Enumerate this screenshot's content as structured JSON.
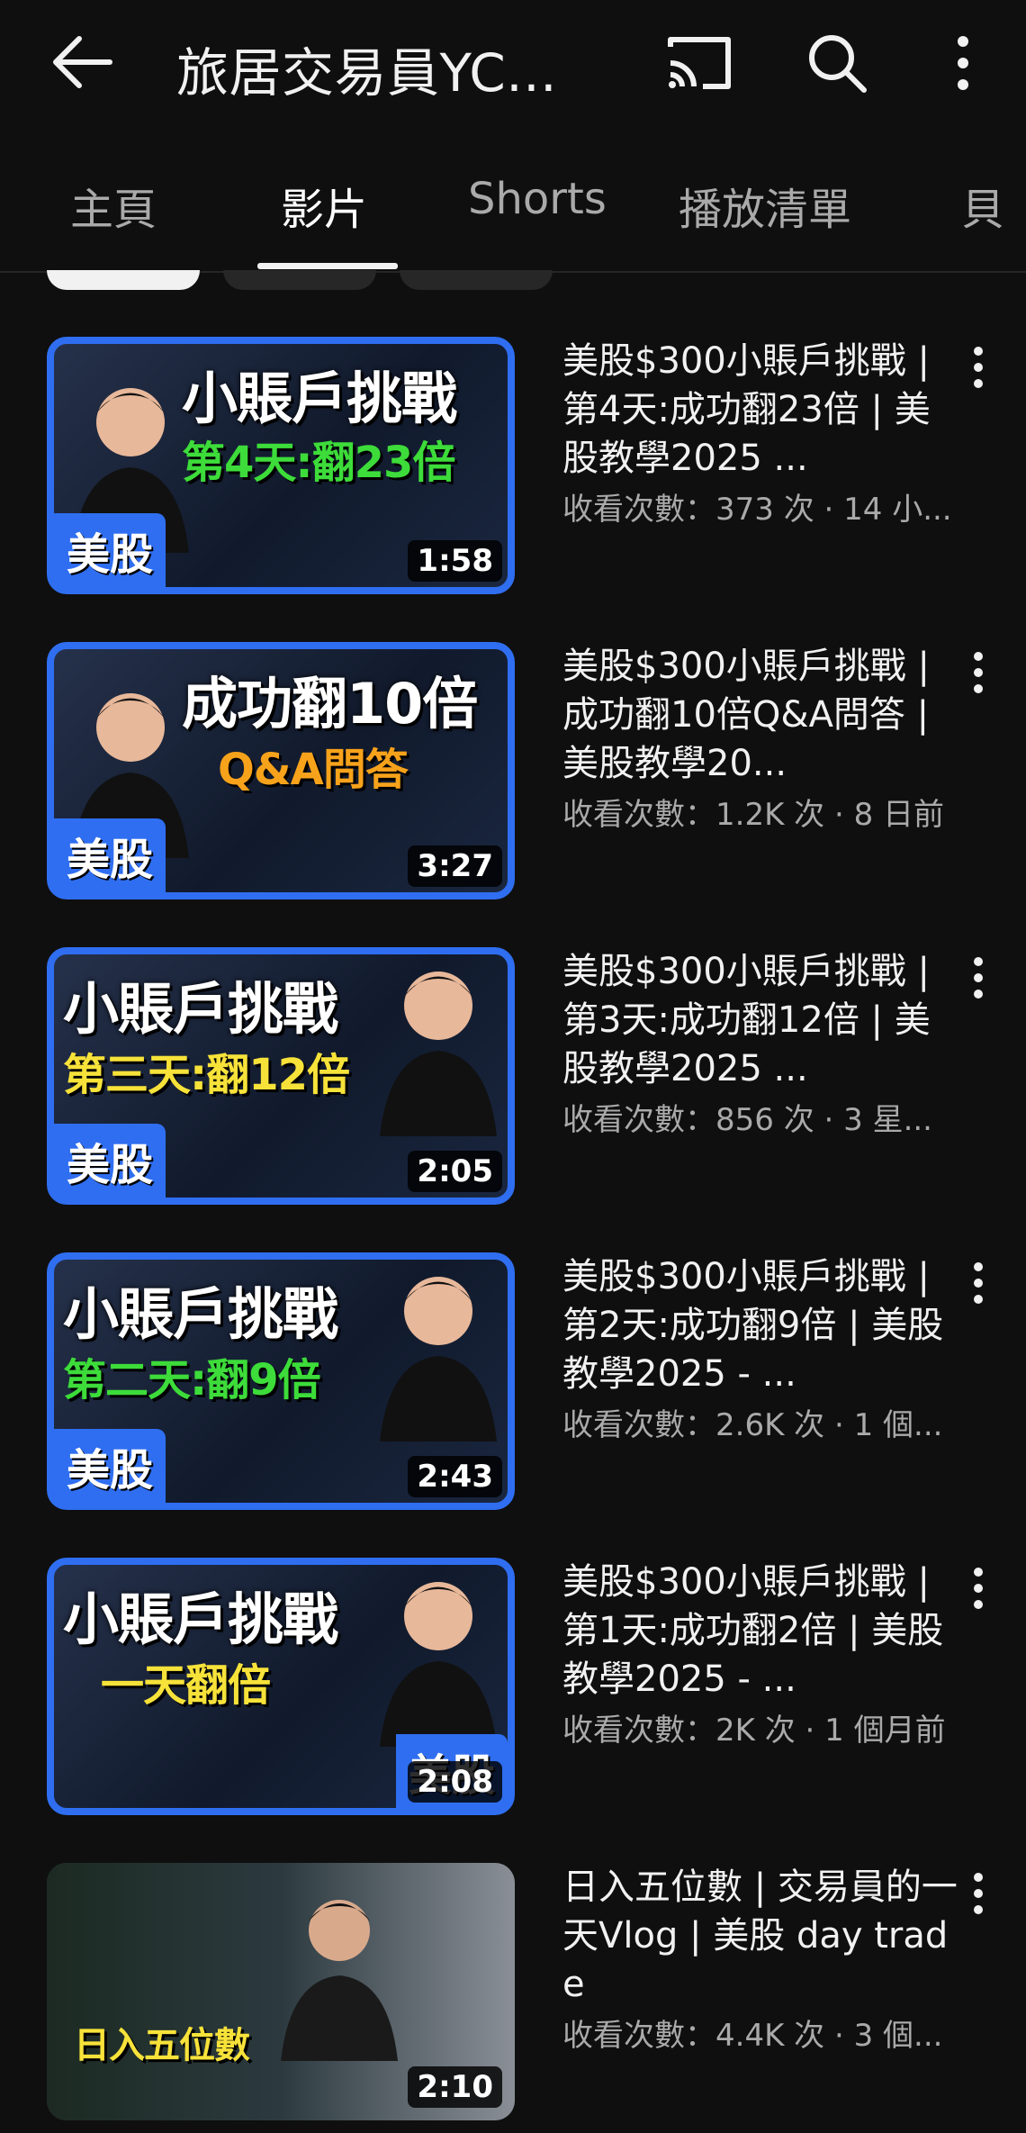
{
  "header": {
    "channel_title": "旅居交易員YC...",
    "back_icon": "arrow-back-icon",
    "cast_icon": "cast-icon",
    "search_icon": "search-icon",
    "more_icon": "more-vert-icon"
  },
  "tabs": [
    {
      "label": "主頁",
      "active": false
    },
    {
      "label": "影片",
      "active": true
    },
    {
      "label": "Shorts",
      "active": false
    },
    {
      "label": "播放清單",
      "active": false
    },
    {
      "label": "貝",
      "active": false
    }
  ],
  "videos": [
    {
      "title": "美股$300小賬戶挑戰 | 第4天:成功翻23倍 | 美股教學2025 ...",
      "meta": "收看次數：373 次 · 14 小...",
      "duration": "1:58",
      "thumb_headline": "小賬戶挑戰",
      "thumb_sub": "第4天:翻23倍",
      "thumb_badge": "美股"
    },
    {
      "title": "美股$300小賬戶挑戰 | 成功翻10倍Q&A問答 | 美股教學20...",
      "meta": "收看次數：1.2K 次 · 8 日前",
      "duration": "3:27",
      "thumb_headline": "成功翻10倍",
      "thumb_sub": "Q&A問答",
      "thumb_badge": "美股"
    },
    {
      "title": "美股$300小賬戶挑戰 | 第3天:成功翻12倍 | 美股教學2025 ...",
      "meta": "收看次數：856 次 · 3 星...",
      "duration": "2:05",
      "thumb_headline": "小賬戶挑戰",
      "thumb_sub": "第三天:翻12倍",
      "thumb_badge": "美股"
    },
    {
      "title": "美股$300小賬戶挑戰 | 第2天:成功翻9倍 | 美股教學2025 - ...",
      "meta": "收看次數：2.6K 次 · 1 個...",
      "duration": "2:43",
      "thumb_headline": "小賬戶挑戰",
      "thumb_sub": "第二天:翻9倍",
      "thumb_badge": "美股"
    },
    {
      "title": "美股$300小賬戶挑戰 | 第1天:成功翻2倍 | 美股教學2025 - ...",
      "meta": "收看次數：2K 次 · 1 個月前",
      "duration": "2:08",
      "thumb_headline": "小賬戶挑戰",
      "thumb_sub": "一天翻倍",
      "thumb_badge": "美股"
    },
    {
      "title": "日入五位數 | 交易員的一天Vlog | 美股 day trade",
      "meta": "收看次數：4.4K 次 · 3 個...",
      "duration": "2:10",
      "thumb_headline": "",
      "thumb_sub": "日入五位數",
      "thumb_badge": ""
    }
  ],
  "colors": {
    "background": "#0f0f0f",
    "text_primary": "#f1f1f1",
    "text_secondary": "#aaaaaa",
    "thumb_accent": "#2f6ef0",
    "thumb_green": "#3ddc3a",
    "thumb_yellow": "#f7e23a",
    "thumb_orange": "#f7a21b"
  }
}
